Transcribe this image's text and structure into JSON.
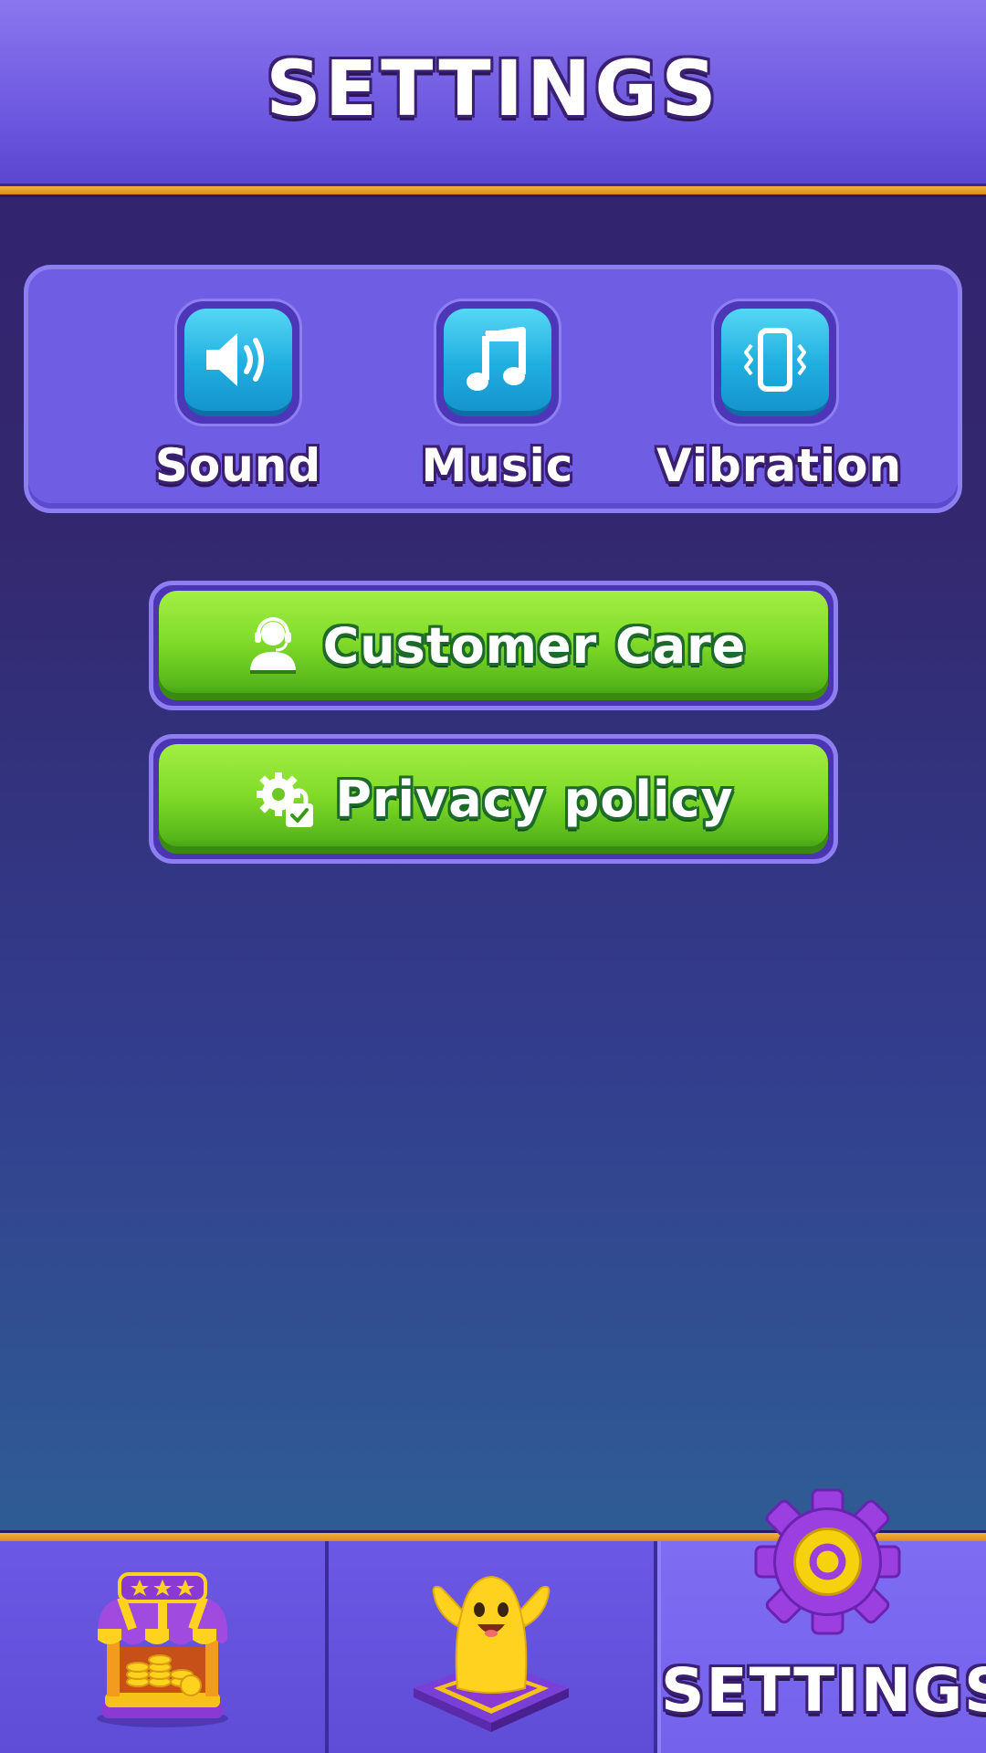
{
  "header": {
    "title": "SETTINGS"
  },
  "toggles": [
    {
      "label": "Sound",
      "icon": "speaker-icon"
    },
    {
      "label": "Music",
      "icon": "music-note-icon"
    },
    {
      "label": "Vibration",
      "icon": "vibration-phone-icon"
    }
  ],
  "buttons": {
    "customer_care": {
      "label": "Customer Care",
      "icon": "headset-person-icon"
    },
    "privacy_policy": {
      "label": "Privacy policy",
      "icon": "gear-lock-icon"
    }
  },
  "bottom_nav": {
    "tabs": [
      {
        "name": "shop",
        "icon": "shop-stall-icon",
        "active": false
      },
      {
        "name": "play",
        "icon": "character-icon",
        "active": false
      },
      {
        "name": "settings",
        "label": "SETTINGS",
        "icon": "gear-icon",
        "active": true
      }
    ]
  },
  "colors": {
    "header": "#6a55de",
    "accent_stripe": "#f2b23a",
    "tile_blue": "#20aee0",
    "button_green": "#82dc2a",
    "gear_purple": "#9b3fe0",
    "gear_yellow": "#f5d20c"
  }
}
